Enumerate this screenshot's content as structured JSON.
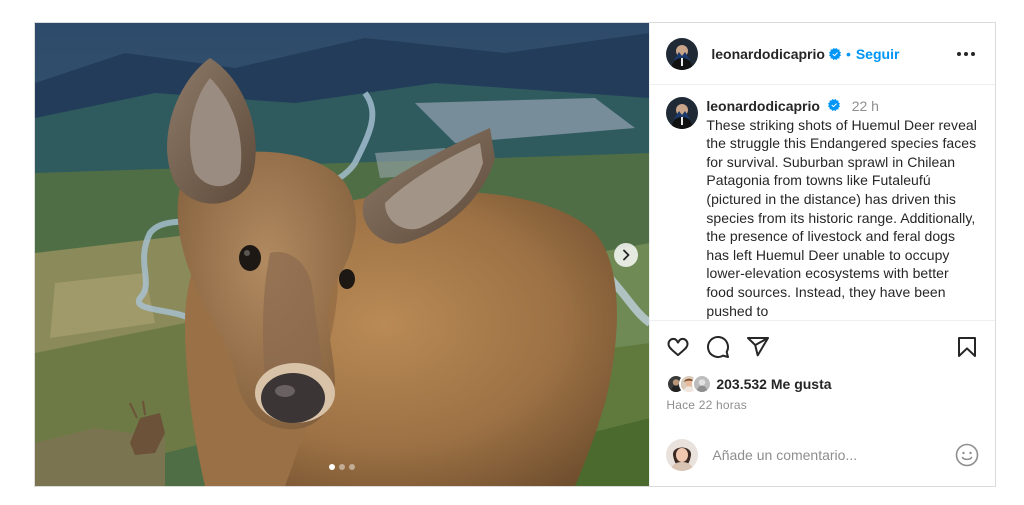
{
  "post": {
    "author": "leonardodicaprio",
    "follow_label": "Seguir",
    "separator": "•",
    "caption": {
      "author": "leonardodicaprio",
      "time": "22 h",
      "text": "These striking shots of Huemul Deer reveal the struggle this Endangered species faces for survival. Suburban sprawl in Chilean Patagonia from towns like Futaleufú (pictured in the distance) has driven this species from its historic range. Additionally, the presence of livestock and feral dogs has left Huemul Deer unable to occupy lower-elevation ecosystems with better food sources. Instead, they have been pushed to"
    },
    "likes": "203.532 Me gusta",
    "posted": "Hace 22 horas",
    "comment_placeholder": "Añade un comentario...",
    "carousel": {
      "total": 3,
      "active": 1
    },
    "icons": [
      "verified-badge-icon",
      "more-options-icon",
      "heart-icon",
      "comment-icon",
      "share-icon",
      "bookmark-icon",
      "chevron-right-icon",
      "emoji-icon"
    ],
    "colors": {
      "accent": "#0095f6",
      "text": "#262626",
      "muted": "#8e8e8e",
      "border": "#dbdbdb"
    }
  }
}
